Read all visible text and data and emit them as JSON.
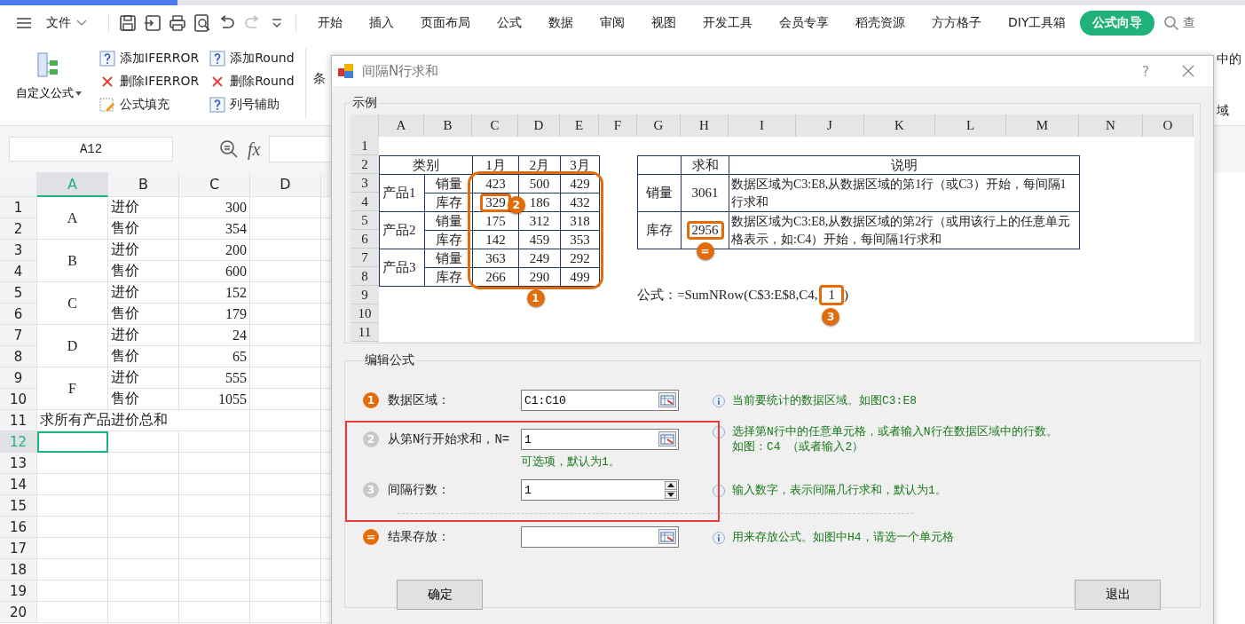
{
  "menu_bar": {
    "file_label": "文件",
    "tabs": [
      {
        "label": "开始",
        "selected": false
      },
      {
        "label": "插入",
        "selected": false
      },
      {
        "label": "页面布局",
        "selected": false
      },
      {
        "label": "公式",
        "selected": false
      },
      {
        "label": "数据",
        "selected": false
      },
      {
        "label": "审阅",
        "selected": false
      },
      {
        "label": "视图",
        "selected": false
      },
      {
        "label": "开发工具",
        "selected": false
      },
      {
        "label": "会员专享",
        "selected": false
      },
      {
        "label": "稻壳资源",
        "selected": false
      },
      {
        "label": "方方格子",
        "selected": false
      },
      {
        "label": "DIY工具箱",
        "selected": false
      },
      {
        "label": "公式向导",
        "selected": true
      }
    ],
    "quick_tools": [
      {
        "kind": "save",
        "disabled": false
      },
      {
        "kind": "export",
        "disabled": false
      },
      {
        "kind": "print",
        "disabled": false
      },
      {
        "kind": "preview",
        "disabled": false
      },
      {
        "kind": "undo",
        "disabled": false
      },
      {
        "kind": "redo",
        "disabled": true
      }
    ],
    "search_label": "查"
  },
  "ribbon": {
    "custom_formula": "自定义公式",
    "columns": [
      [
        {
          "kind": "help",
          "label": "添加IFERROR"
        },
        {
          "kind": "delete",
          "label": "删除IFERROR"
        },
        {
          "kind": "fill",
          "label": "公式填充"
        }
      ],
      [
        {
          "kind": "help",
          "label": "添加Round"
        },
        {
          "kind": "delete",
          "label": "删除Round"
        },
        {
          "kind": "help",
          "label": "列号辅助"
        }
      ]
    ],
    "partial_label": "条",
    "right_partial_labels": [
      "中的",
      "域"
    ]
  },
  "formula_bar": {
    "name_box": "A12",
    "fx": "fx"
  },
  "sheet": {
    "column_headers": [
      {
        "label": "A",
        "selected": true
      },
      {
        "label": "B",
        "selected": false
      },
      {
        "label": "C",
        "selected": false
      },
      {
        "label": "D",
        "selected": false
      }
    ],
    "row_headers": [
      {
        "label": "1",
        "selected": false
      },
      {
        "label": "2",
        "selected": false
      },
      {
        "label": "3",
        "selected": false
      },
      {
        "label": "4",
        "selected": false
      },
      {
        "label": "5",
        "selected": false
      },
      {
        "label": "6",
        "selected": false
      },
      {
        "label": "7",
        "selected": false
      },
      {
        "label": "8",
        "selected": false
      },
      {
        "label": "9",
        "selected": false
      },
      {
        "label": "10",
        "selected": false
      },
      {
        "label": "11",
        "selected": false
      },
      {
        "label": "12",
        "selected": true
      },
      {
        "label": "13",
        "selected": false
      },
      {
        "label": "14",
        "selected": false
      },
      {
        "label": "15",
        "selected": false
      },
      {
        "label": "16",
        "selected": false
      },
      {
        "label": "17",
        "selected": false
      },
      {
        "label": "18",
        "selected": false
      },
      {
        "label": "19",
        "selected": false
      },
      {
        "label": "20",
        "selected": false
      }
    ],
    "products": [
      {
        "name": "A",
        "entries": [
          {
            "label": "进价",
            "value": "300"
          },
          {
            "label": "售价",
            "value": "354"
          }
        ]
      },
      {
        "name": "B",
        "entries": [
          {
            "label": "进价",
            "value": "200"
          },
          {
            "label": "售价",
            "value": "600"
          }
        ]
      },
      {
        "name": "C",
        "entries": [
          {
            "label": "进价",
            "value": "152"
          },
          {
            "label": "售价",
            "value": "179"
          }
        ]
      },
      {
        "name": "D",
        "entries": [
          {
            "label": "进价",
            "value": "24"
          },
          {
            "label": "售价",
            "value": "65"
          }
        ]
      },
      {
        "name": "F",
        "entries": [
          {
            "label": "进价",
            "value": "555"
          },
          {
            "label": "售价",
            "value": "1055"
          }
        ]
      }
    ],
    "note": "求所有产品进价总和"
  },
  "dialog": {
    "title": "间隔N行求和",
    "help": "?",
    "example": {
      "label": "示例",
      "columns": [
        "A",
        "B",
        "C",
        "D",
        "E",
        "F",
        "G",
        "H",
        "I",
        "J",
        "K",
        "L",
        "M",
        "N",
        "O"
      ],
      "rows": [
        "1",
        "2",
        "3",
        "4",
        "5",
        "6",
        "7",
        "8",
        "9",
        "10",
        "11"
      ],
      "category_header": "类别",
      "months": [
        "1月",
        "2月",
        "3月"
      ],
      "products": [
        {
          "name": "产品1",
          "rows": [
            {
              "metric": "销量",
              "values": [
                "423",
                "500",
                "429"
              ]
            },
            {
              "metric": "库存",
              "values": [
                "329",
                "186",
                "432"
              ]
            }
          ]
        },
        {
          "name": "产品2",
          "rows": [
            {
              "metric": "销量",
              "values": [
                "175",
                "312",
                "318"
              ]
            },
            {
              "metric": "库存",
              "values": [
                "142",
                "459",
                "353"
              ]
            }
          ]
        },
        {
          "name": "产品3",
          "rows": [
            {
              "metric": "销量",
              "values": [
                "363",
                "249",
                "292"
              ]
            },
            {
              "metric": "库存",
              "values": [
                "266",
                "290",
                "499"
              ]
            }
          ]
        }
      ],
      "sum_header": "求和",
      "note_header": "说明",
      "results": [
        {
          "metric": "销量",
          "sum": "3061",
          "note": "数据区域为C3:E8,从数据区域的第1行（或C3）开始，每间隔1行求和"
        },
        {
          "metric": "库存",
          "sum": "2956",
          "note": "数据区域为C3:E8,从数据区域的第2行（或用该行上的任意单元格表示，如:C4）开始，每间隔1行求和"
        }
      ],
      "formula_prefix": "公式：=SumNRow(C$3:E$8,C4,",
      "formula_arg": "1",
      "formula_suffix": ")",
      "markers": [
        "1",
        "2",
        "=",
        "3"
      ]
    },
    "edit": {
      "label": "编辑公式",
      "fields": [
        {
          "badge": "1",
          "active": true,
          "label": "数据区域：",
          "value": "C1:C10",
          "kind": "range",
          "hint": [
            "当前要统计的数据区域。如图C3:E8"
          ]
        },
        {
          "badge": "2",
          "active": false,
          "label": "从第N行开始求和，N=",
          "value": "1",
          "kind": "range",
          "sub_hint": "可选项，默认为1。",
          "hint": [
            "选择第N行中的任意单元格，或者输入N行在数据区域中的行数。",
            "如图：C4 （或者输入2）"
          ]
        },
        {
          "badge": "3",
          "active": false,
          "label": "间隔行数：",
          "value": "1",
          "kind": "spin",
          "hint": [
            "输入数字，表示间隔几行求和，默认为1。"
          ]
        },
        {
          "badge": "=",
          "active": true,
          "label": "结果存放：",
          "kind": "range",
          "hint": [
            "用来存放公式。如图中H4，请选一个单元格"
          ]
        }
      ],
      "buttons": [
        "确定",
        "退出"
      ]
    }
  }
}
